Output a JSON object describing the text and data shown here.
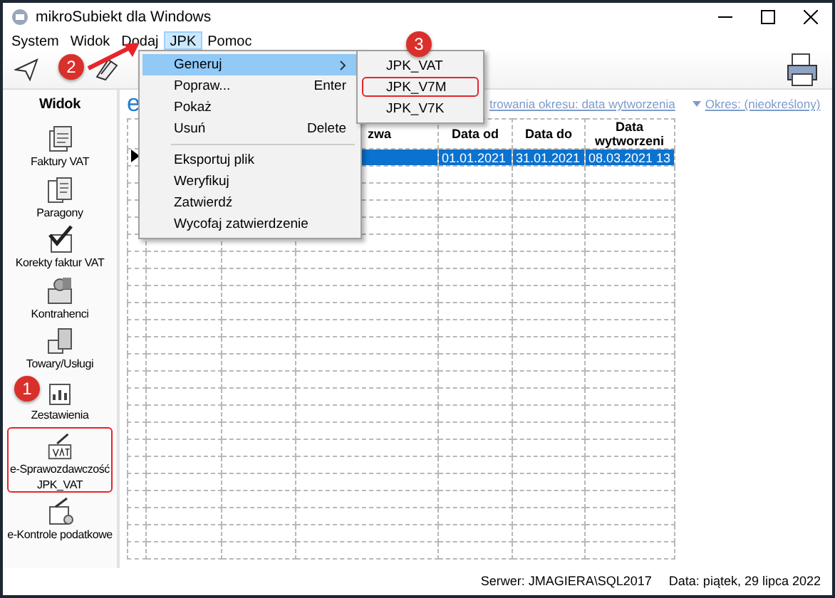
{
  "window": {
    "title": "mikroSubiekt dla Windows"
  },
  "menu_bar": [
    {
      "label": "System",
      "selected": false
    },
    {
      "label": "Widok",
      "selected": false
    },
    {
      "label": "Dodaj",
      "selected": false
    },
    {
      "label": "JPK",
      "selected": true
    },
    {
      "label": "Pomoc",
      "selected": false
    }
  ],
  "sidebar": {
    "title": "Widok",
    "items": [
      {
        "label": "Faktury VAT",
        "highlighted": false
      },
      {
        "label": "Paragony",
        "highlighted": false
      },
      {
        "label": "Korekty faktur VAT",
        "highlighted": false
      },
      {
        "label": "Kontrahenci",
        "highlighted": false
      },
      {
        "label": "Towary/Usługi",
        "highlighted": false
      },
      {
        "label": "Zestawienia",
        "highlighted": false
      },
      {
        "label": "e-Sprawozdawczość JPK_VAT",
        "highlighted": true
      },
      {
        "label": "e-Kontrole podatkowe",
        "highlighted": false
      }
    ]
  },
  "main": {
    "heading": "e",
    "filter_link": "trowania okresu: data wytworzenia",
    "period_link": "Okres: (nieokreślony)"
  },
  "table": {
    "columns": [
      "",
      "",
      "",
      "zwa",
      "Data od",
      "Data do",
      "Data wytworzeni"
    ],
    "rows": [
      {
        "selected": true,
        "cells": [
          "",
          "",
          "",
          "",
          "01.01.2021",
          "31.01.2021",
          "08.03.2021 13"
        ]
      }
    ]
  },
  "menu": {
    "items": [
      {
        "kind": "item",
        "label": "Generuj",
        "selected": true,
        "submenu": true
      },
      {
        "kind": "item",
        "label": "Popraw...",
        "shortcut": "Enter",
        "selected": false
      },
      {
        "kind": "item",
        "label": "Pokaż",
        "selected": false
      },
      {
        "kind": "item",
        "label": "Usuń",
        "shortcut": "Delete",
        "selected": false
      },
      {
        "kind": "separator"
      },
      {
        "kind": "item",
        "label": "Eksportuj plik",
        "selected": false
      },
      {
        "kind": "item",
        "label": "Weryfikuj",
        "selected": false
      },
      {
        "kind": "item",
        "label": "Zatwierdź",
        "selected": false
      },
      {
        "kind": "item",
        "label": "Wycofaj zatwierdzenie",
        "selected": false
      }
    ]
  },
  "submenu": {
    "items": [
      {
        "label": "JPK_VAT",
        "highlighted": false
      },
      {
        "label": "JPK_V7M",
        "highlighted": true
      },
      {
        "label": "JPK_V7K",
        "highlighted": false
      }
    ]
  },
  "status_bar": {
    "server": "Serwer: JMAGIERA\\SQL2017",
    "date": "Data: piątek, 29 lipca 2022"
  },
  "annotations": {
    "badges": [
      "1",
      "2",
      "3"
    ]
  }
}
